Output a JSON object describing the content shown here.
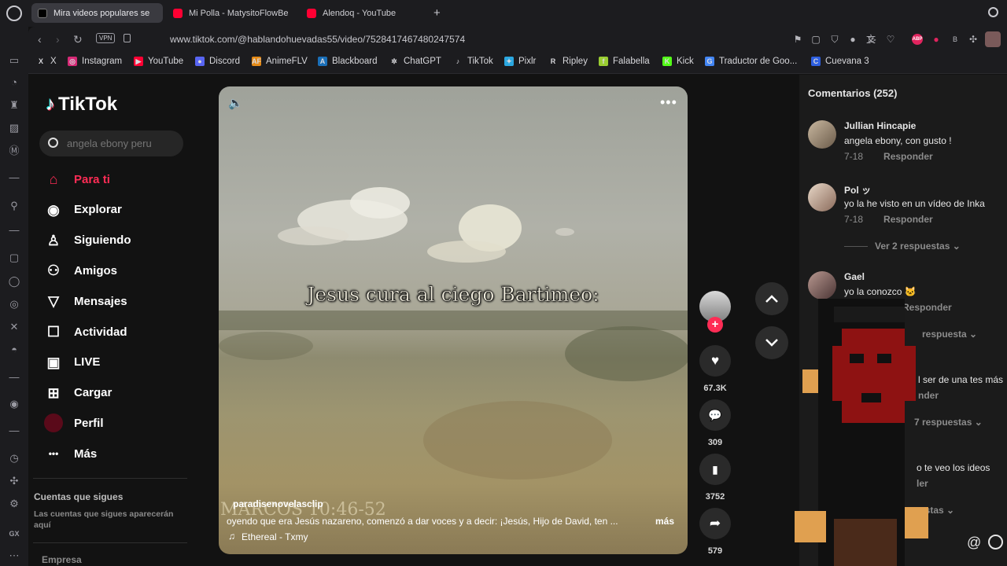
{
  "browser": {
    "tabs": [
      {
        "label": "Mira videos populares se",
        "active": true,
        "fav_color": "#ffffff"
      },
      {
        "label": "Mi Polla - MatysitoFlowBe",
        "active": false,
        "fav_color": "#ff0033"
      },
      {
        "label": "Alendoq - YouTube",
        "active": false,
        "fav_color": "#ff0033"
      }
    ],
    "new_tab": "+",
    "url": "www.tiktok.com/@hablandohuevadas55/video/7528417467480247574",
    "vpn": "VPN",
    "bookmarks": [
      {
        "label": "X",
        "icon_text": "X",
        "color": "#1c1c1f"
      },
      {
        "label": "Instagram",
        "icon_text": "◎",
        "color": "#d62976"
      },
      {
        "label": "YouTube",
        "icon_text": "▶",
        "color": "#ff0033"
      },
      {
        "label": "Discord",
        "icon_text": "●",
        "color": "#5865f2"
      },
      {
        "label": "AnimeFLV",
        "icon_text": "AF",
        "color": "#e58a16"
      },
      {
        "label": "Blackboard",
        "icon_text": "A",
        "color": "#1a6fb8"
      },
      {
        "label": "ChatGPT",
        "icon_text": "✲",
        "color": "#1c1c1f"
      },
      {
        "label": "TikTok",
        "icon_text": "♪",
        "color": "#1c1c1f"
      },
      {
        "label": "Pixlr",
        "icon_text": "✦",
        "color": "#2ba7e0"
      },
      {
        "label": "Ripley",
        "icon_text": "R",
        "color": "#1c1c1f"
      },
      {
        "label": "Falabella",
        "icon_text": "f",
        "color": "#9acd32"
      },
      {
        "label": "Kick",
        "icon_text": "K",
        "color": "#53fc18"
      },
      {
        "label": "Traductor de Goo...",
        "icon_text": "G",
        "color": "#4285f4"
      },
      {
        "label": "Cuevana 3",
        "icon_text": "C",
        "color": "#2e5fe0"
      }
    ]
  },
  "tiktok": {
    "logo": "TikTok",
    "search_placeholder": "angela ebony peru",
    "nav": [
      {
        "label": "Para ti",
        "icon": "home-icon",
        "glyph": "⌂",
        "active": true
      },
      {
        "label": "Explorar",
        "icon": "compass-icon",
        "glyph": "◉",
        "active": false
      },
      {
        "label": "Siguiendo",
        "icon": "following-icon",
        "glyph": "♙",
        "active": false
      },
      {
        "label": "Amigos",
        "icon": "friends-icon",
        "glyph": "⚇",
        "active": false
      },
      {
        "label": "Mensajes",
        "icon": "messages-icon",
        "glyph": "▽",
        "active": false
      },
      {
        "label": "Actividad",
        "icon": "activity-icon",
        "glyph": "☐",
        "active": false
      },
      {
        "label": "LIVE",
        "icon": "live-icon",
        "glyph": "▣",
        "active": false
      },
      {
        "label": "Cargar",
        "icon": "upload-icon",
        "glyph": "⊞",
        "active": false
      },
      {
        "label": "Perfil",
        "icon": "profile-avatar-icon",
        "glyph": "",
        "active": false
      },
      {
        "label": "Más",
        "icon": "more-icon",
        "glyph": "•••",
        "active": false
      }
    ],
    "following_title": "Cuentas que sigues",
    "following_text": "Las cuentas que sigues aparecerán aquí",
    "footer": "Empresa",
    "video": {
      "subtitle": "Jesus cura al ciego Bartimeo:",
      "watermark": "MARCOS 10:46-52",
      "author": "paradisenovelasclip",
      "caption": "oyendo que era Jesús nazareno, comenzó a dar voces y a decir: ¡Jesús, Hijo de David, ten ...",
      "more": "más",
      "music": "Ethereal - Txmy"
    },
    "actions": {
      "likes": "67.3K",
      "comments": "309",
      "saves": "3752",
      "shares": "579"
    },
    "comments_panel": {
      "title": "Comentarios (252)",
      "items": [
        {
          "user": "Jullian Hincapie",
          "text": "angela ebony, con gusto !",
          "date": "7-18",
          "reply": "Responder"
        },
        {
          "user": "Pol ッ",
          "text": "yo la he visto en un vídeo de Inka",
          "date": "7-18",
          "reply": "Responder"
        },
        {
          "user": "Gael",
          "text": "yo la conozco 🐱",
          "date": "",
          "reply": "Responder"
        }
      ],
      "view_replies": "Ver 2 respuestas",
      "partial": {
        "replies1": "respuesta",
        "text2": "l ser de una tes más",
        "reply2": "nder",
        "replies2": "7 respuestas",
        "text3": "o te veo los ideos",
        "reply3": "ler",
        "replies3": "estas"
      }
    }
  }
}
